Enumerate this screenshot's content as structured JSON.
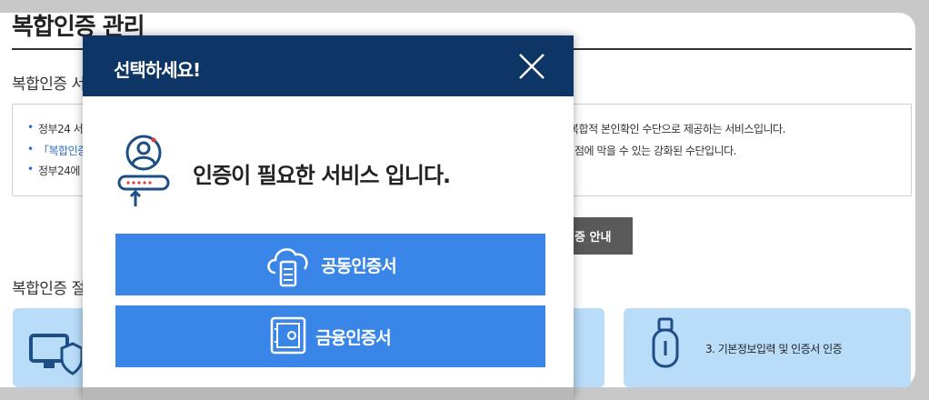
{
  "page": {
    "title": "복합인증 관리",
    "section1_heading": "복합인증 서",
    "section2_heading": "복합인증 절",
    "info_lines": [
      {
        "left": "정부24 서",
        "right": "복합적 본인확인 수단으로 제공하는 서비스입니다."
      },
      {
        "left": "「복합인증",
        "right": "점에 막을 수 있는 강화된 수단입니다."
      },
      {
        "left": "정부24에",
        "right": ""
      }
    ],
    "guide_button_label": "증 안내",
    "step3_label": "3. 기본정보입력 및 인증서 인증"
  },
  "modal": {
    "title": "선택하세요!",
    "message": "인증이 필요한 서비스 입니다.",
    "buttons": [
      {
        "label": "공동인증서",
        "icon": "cloud-server-icon"
      },
      {
        "label": "금융인증서",
        "icon": "safe-icon"
      }
    ]
  },
  "colors": {
    "modal_header": "#0d3666",
    "button_blue": "#3a86e8",
    "step_card": "#b9dcf8",
    "guide_button": "#5a5a5a",
    "overlay": "#c8c8c8"
  }
}
